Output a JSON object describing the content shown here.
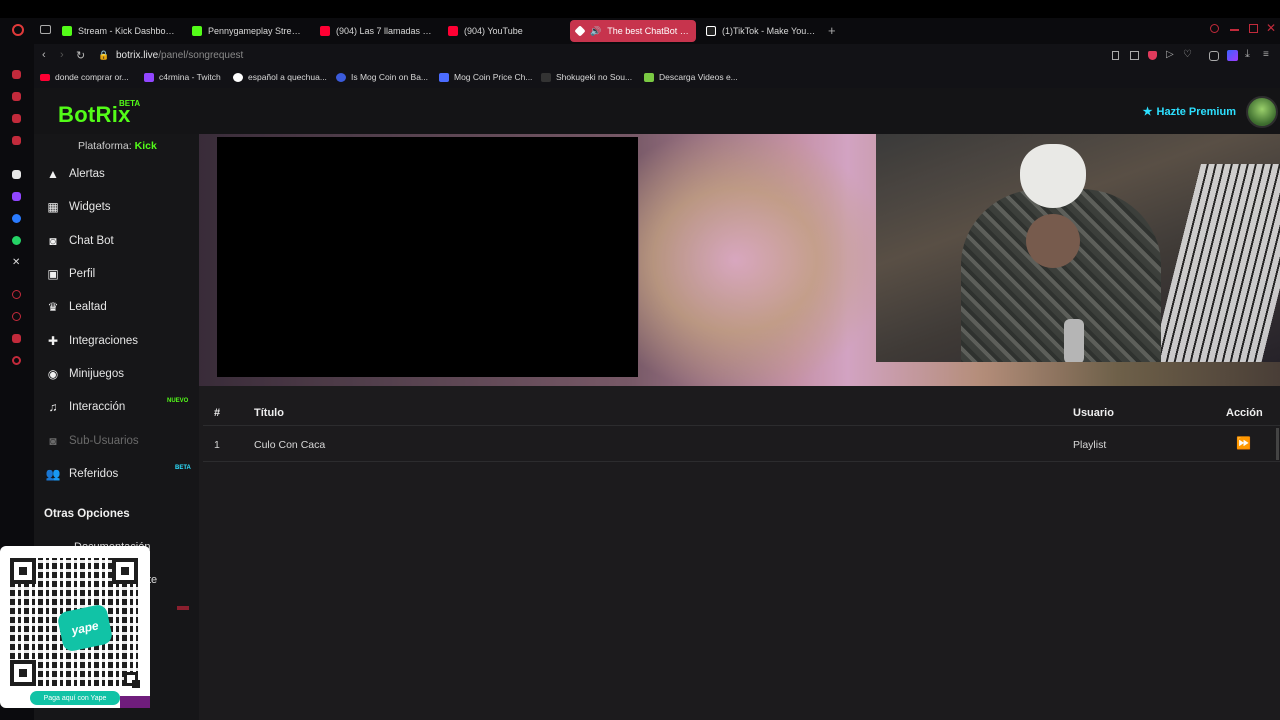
{
  "browser": {
    "tabs": [
      {
        "label": "Stream - Kick Dashboard",
        "favicon_color": "#53fc18"
      },
      {
        "label": "Pennygameplay Stream",
        "favicon_color": "#53fc18"
      },
      {
        "label": "(904) Las 7 llamadas más",
        "favicon_color": "#ff0033"
      },
      {
        "label": "(904) YouTube",
        "favicon_color": "#ff0033"
      },
      {
        "label": "The best ChatBot and",
        "favicon_color": "#ffffff",
        "active": true
      },
      {
        "label": "(1)TikTok - Make Your Da",
        "favicon_color": "#ffffff"
      }
    ],
    "url_host": "botrix.live",
    "url_path": "/panel/songrequest",
    "bookmarks": [
      "donde comprar or...",
      "c4rmina - Twitch",
      "español a quechua...",
      "Is Mog Coin on Ba...",
      "Mog Coin Price Ch...",
      "Shokugeki no Sou...",
      "Descarga Videos e..."
    ]
  },
  "app": {
    "logo": "BotRix",
    "beta": "BETA",
    "premium": "Hazte Premium",
    "platform_label": "Plataforma:",
    "platform_value": "Kick",
    "accent": "#53fc18"
  },
  "sidebar": {
    "items": [
      {
        "label": "Alertas",
        "icon": "warning-icon"
      },
      {
        "label": "Widgets",
        "icon": "grid-icon"
      },
      {
        "label": "Chat Bot",
        "icon": "robot-icon"
      },
      {
        "label": "Perfil",
        "icon": "id-card-icon"
      },
      {
        "label": "Lealtad",
        "icon": "trophy-icon"
      },
      {
        "label": "Integraciones",
        "icon": "puzzle-icon"
      },
      {
        "label": "Minijuegos",
        "icon": "gamepad-icon"
      },
      {
        "label": "Interacción",
        "icon": "music-icon",
        "badge": "NUEVO"
      },
      {
        "label": "Sub-Usuarios",
        "icon": "robot-icon",
        "disabled": true
      },
      {
        "label": "Referidos",
        "icon": "users-icon",
        "badge": "BETA"
      }
    ],
    "other_heading": "Otras Opciones",
    "other_partial_1": "Documentación",
    "other_partial_2": "te"
  },
  "songtable": {
    "headers": {
      "num": "#",
      "title": "Título",
      "user": "Usuario",
      "action": "Acción"
    },
    "rows": [
      {
        "num": "1",
        "title": "Culo Con Caca",
        "user": "Playlist",
        "action_icon": "fast-forward-icon"
      }
    ]
  },
  "qr": {
    "logo_text": "yape",
    "caption": "Paga aquí con Yape"
  }
}
